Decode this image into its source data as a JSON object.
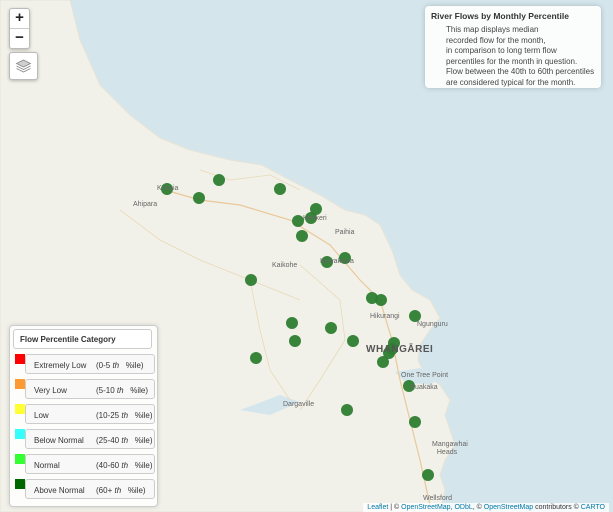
{
  "map": {
    "zoom_in": "+",
    "zoom_out": "−",
    "layers_icon": "layers-icon",
    "places": [
      {
        "id": "kaitaia",
        "name": "Kaitaia"
      },
      {
        "id": "ahipara",
        "name": "Ahipara"
      },
      {
        "id": "kerikeri",
        "name": "Kerikeri"
      },
      {
        "id": "paihia",
        "name": "Paihia"
      },
      {
        "id": "kawakawa",
        "name": "Kawakawa"
      },
      {
        "id": "kaikohe",
        "name": "Kaikohe"
      },
      {
        "id": "hikurangi",
        "name": "Hikurangi"
      },
      {
        "id": "ngunguru",
        "name": "Ngunguru"
      },
      {
        "id": "whangarei",
        "name": "WHANGĀREI"
      },
      {
        "id": "onetreepoint",
        "name": "One Tree Point"
      },
      {
        "id": "ruakaka",
        "name": "Ruakaka"
      },
      {
        "id": "dargaville",
        "name": "Dargaville"
      },
      {
        "id": "mangawhai",
        "name": "Mangawhai Heads"
      },
      {
        "id": "wellsford",
        "name": "Wellsford"
      }
    ],
    "sites": [
      {
        "category": "Above Normal"
      },
      {
        "category": "Above Normal"
      },
      {
        "category": "Above Normal"
      },
      {
        "category": "Above Normal"
      },
      {
        "category": "Above Normal"
      },
      {
        "category": "Above Normal"
      },
      {
        "category": "Above Normal"
      },
      {
        "category": "Above Normal"
      },
      {
        "category": "Above Normal"
      },
      {
        "category": "Above Normal"
      },
      {
        "category": "Above Normal"
      },
      {
        "category": "Above Normal"
      },
      {
        "category": "Above Normal"
      },
      {
        "category": "Above Normal"
      },
      {
        "category": "Above Normal"
      },
      {
        "category": "Above Normal"
      },
      {
        "category": "Above Normal"
      },
      {
        "category": "Above Normal"
      },
      {
        "category": "Above Normal"
      },
      {
        "category": "Above Normal"
      },
      {
        "category": "Above Normal"
      },
      {
        "category": "Above Normal"
      },
      {
        "category": "Above Normal"
      },
      {
        "category": "Above Normal"
      },
      {
        "category": "Above Normal"
      },
      {
        "category": "Above Normal"
      },
      {
        "category": "Above Normal"
      },
      {
        "category": "Above Normal"
      },
      {
        "category": "Above Normal"
      }
    ]
  },
  "info": {
    "title": "River Flows by Monthly Percentile",
    "lines": [
      "This map displays median",
      "recorded flow for the month,",
      "in comparison to long term flow",
      "percentiles for the month in question.",
      "Flow between the 40th to 60th percentiles",
      "are considered typical for the month."
    ]
  },
  "legend": {
    "title": "Flow Percentile Category",
    "items": [
      {
        "name": "Extremely Low",
        "pre": "(0-5 ",
        "th": "th",
        "post": "%ile)",
        "color": "#ff0000"
      },
      {
        "name": "Very Low",
        "pre": "(5-10 ",
        "th": "th",
        "post": "%ile)",
        "color": "#ff9933"
      },
      {
        "name": "Low",
        "pre": "(10-25 ",
        "th": "th",
        "post": "%ile)",
        "color": "#ffff33"
      },
      {
        "name": "Below Normal",
        "pre": "(25-40 ",
        "th": "th",
        "post": "%ile)",
        "color": "#33ffff"
      },
      {
        "name": "Normal",
        "pre": "(40-60 ",
        "th": "th",
        "post": "%ile)",
        "color": "#33ff33"
      },
      {
        "name": "Above Normal",
        "pre": "(60+ ",
        "th": "th",
        "post": "%ile)",
        "color": "#006600"
      }
    ]
  },
  "attribution": {
    "leaflet": "Leaflet",
    "sep1": " | © ",
    "osm": "OpenStreetMap",
    "sep2": ", ",
    "odbl": "ODbL",
    "sep3": ", © ",
    "osm2": "OpenStreetMap",
    "sep4": " contributors © ",
    "carto": "CARTO"
  },
  "colors": {
    "water": "#d4e6ec",
    "land": "#f2f1e9",
    "marker": "#2e7d32"
  }
}
